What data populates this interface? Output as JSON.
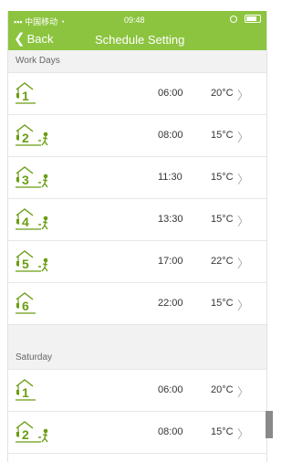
{
  "status": {
    "carrier": "中国移动",
    "time": "09:48"
  },
  "nav": {
    "back_label": "Back",
    "title": "Schedule Setting"
  },
  "sections": [
    {
      "title": "Work Days",
      "rows": [
        {
          "period": "1",
          "figure": false,
          "time": "06:00",
          "temp": "20°C"
        },
        {
          "period": "2",
          "figure": true,
          "time": "08:00",
          "temp": "15°C"
        },
        {
          "period": "3",
          "figure": true,
          "time": "11:30",
          "temp": "15°C"
        },
        {
          "period": "4",
          "figure": true,
          "time": "13:30",
          "temp": "15°C"
        },
        {
          "period": "5",
          "figure": true,
          "time": "17:00",
          "temp": "22°C"
        },
        {
          "period": "6",
          "figure": false,
          "time": "22:00",
          "temp": "15°C"
        }
      ]
    },
    {
      "title": "Saturday",
      "rows": [
        {
          "period": "1",
          "figure": false,
          "time": "06:00",
          "temp": "20°C"
        },
        {
          "period": "2",
          "figure": true,
          "time": "08:00",
          "temp": "15°C"
        }
      ]
    }
  ],
  "colors": {
    "accent": "#8cc43f",
    "icon": "#6a9d12"
  },
  "icons": {
    "chevron": "chevron-right-icon",
    "back": "chevron-left-icon"
  }
}
